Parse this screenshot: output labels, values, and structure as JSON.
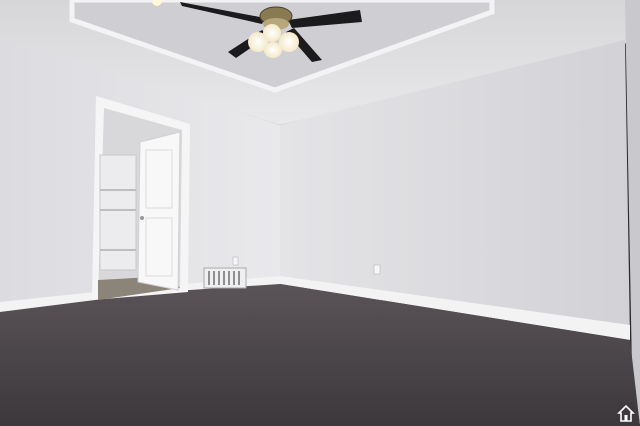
{
  "scene": {
    "description_visible_text": "",
    "colors": {
      "wall_left": "#e6e6e8",
      "wall_back": "#dcdcde",
      "ceiling": "#ececee",
      "tray_ceiling": "#f2f2f3",
      "carpet": "#4a4548",
      "baseboard": "#f4f4f5",
      "door": "#f7f7f8",
      "fan_blade": "#1b1b1d",
      "fan_light": "#fff6d8"
    },
    "icons": {
      "ceiling_fan": "ceiling-fan-icon",
      "floor_vent": "vent-icon",
      "outlet": "outlet-icon",
      "watermark": "house-logo-icon"
    }
  }
}
